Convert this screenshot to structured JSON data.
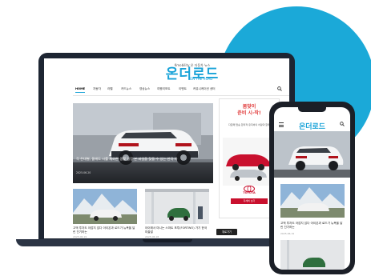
{
  "colors": {
    "accent_blob": "#1ba9d8",
    "logo": "#1aa3d8",
    "laptop_frame": "#1d2532",
    "ad_red": "#e03a3a",
    "toyota_red": "#c9102e"
  },
  "site": {
    "tagline": "Kmobility 온 자동차 뉴스",
    "logo": "온더로드",
    "logo_sub": "ON THE ROAD",
    "nav": [
      "HOME",
      "자동차",
      "라펠",
      "카드뉴스",
      "영상뉴스",
      "여행리포트",
      "이벤트",
      "커뮤니케이션 센터"
    ],
    "search_icon": "search-icon"
  },
  "hero": {
    "caption": "각 찬대별, 울에도 시를 제외한 생활 일정 본 파일을 찾을 수 있는 한국 차",
    "date": "2025.06.20"
  },
  "ad": {
    "headline_1": "봄맞이",
    "headline_2": "준비 시-작!",
    "body": "다함께 탑승 합리적 유지비의 차량과 함께",
    "brand": "TOYOTA",
    "cta": "자세히 보기"
  },
  "cards": [
    {
      "text": "고액 투자도 아깝지 않다 아이온과 로드가 뉴욕을 달린 진기하는",
      "date": "2025.06.19"
    },
    {
      "text": "아이에서 마니는 스마트 포투(FORTWO) 가기 한국 미출발",
      "date": "2025.06.18"
    }
  ],
  "tooltip": "위로가기",
  "phone": {
    "logo": "온더로드",
    "card_text": "고액 투자도 아깝지 않다 아이온과 로드가 뉴욕을 달린 진기하는",
    "card_date": "2025.06.19",
    "menu_icon": "menu-icon",
    "search_icon": "search-icon"
  }
}
